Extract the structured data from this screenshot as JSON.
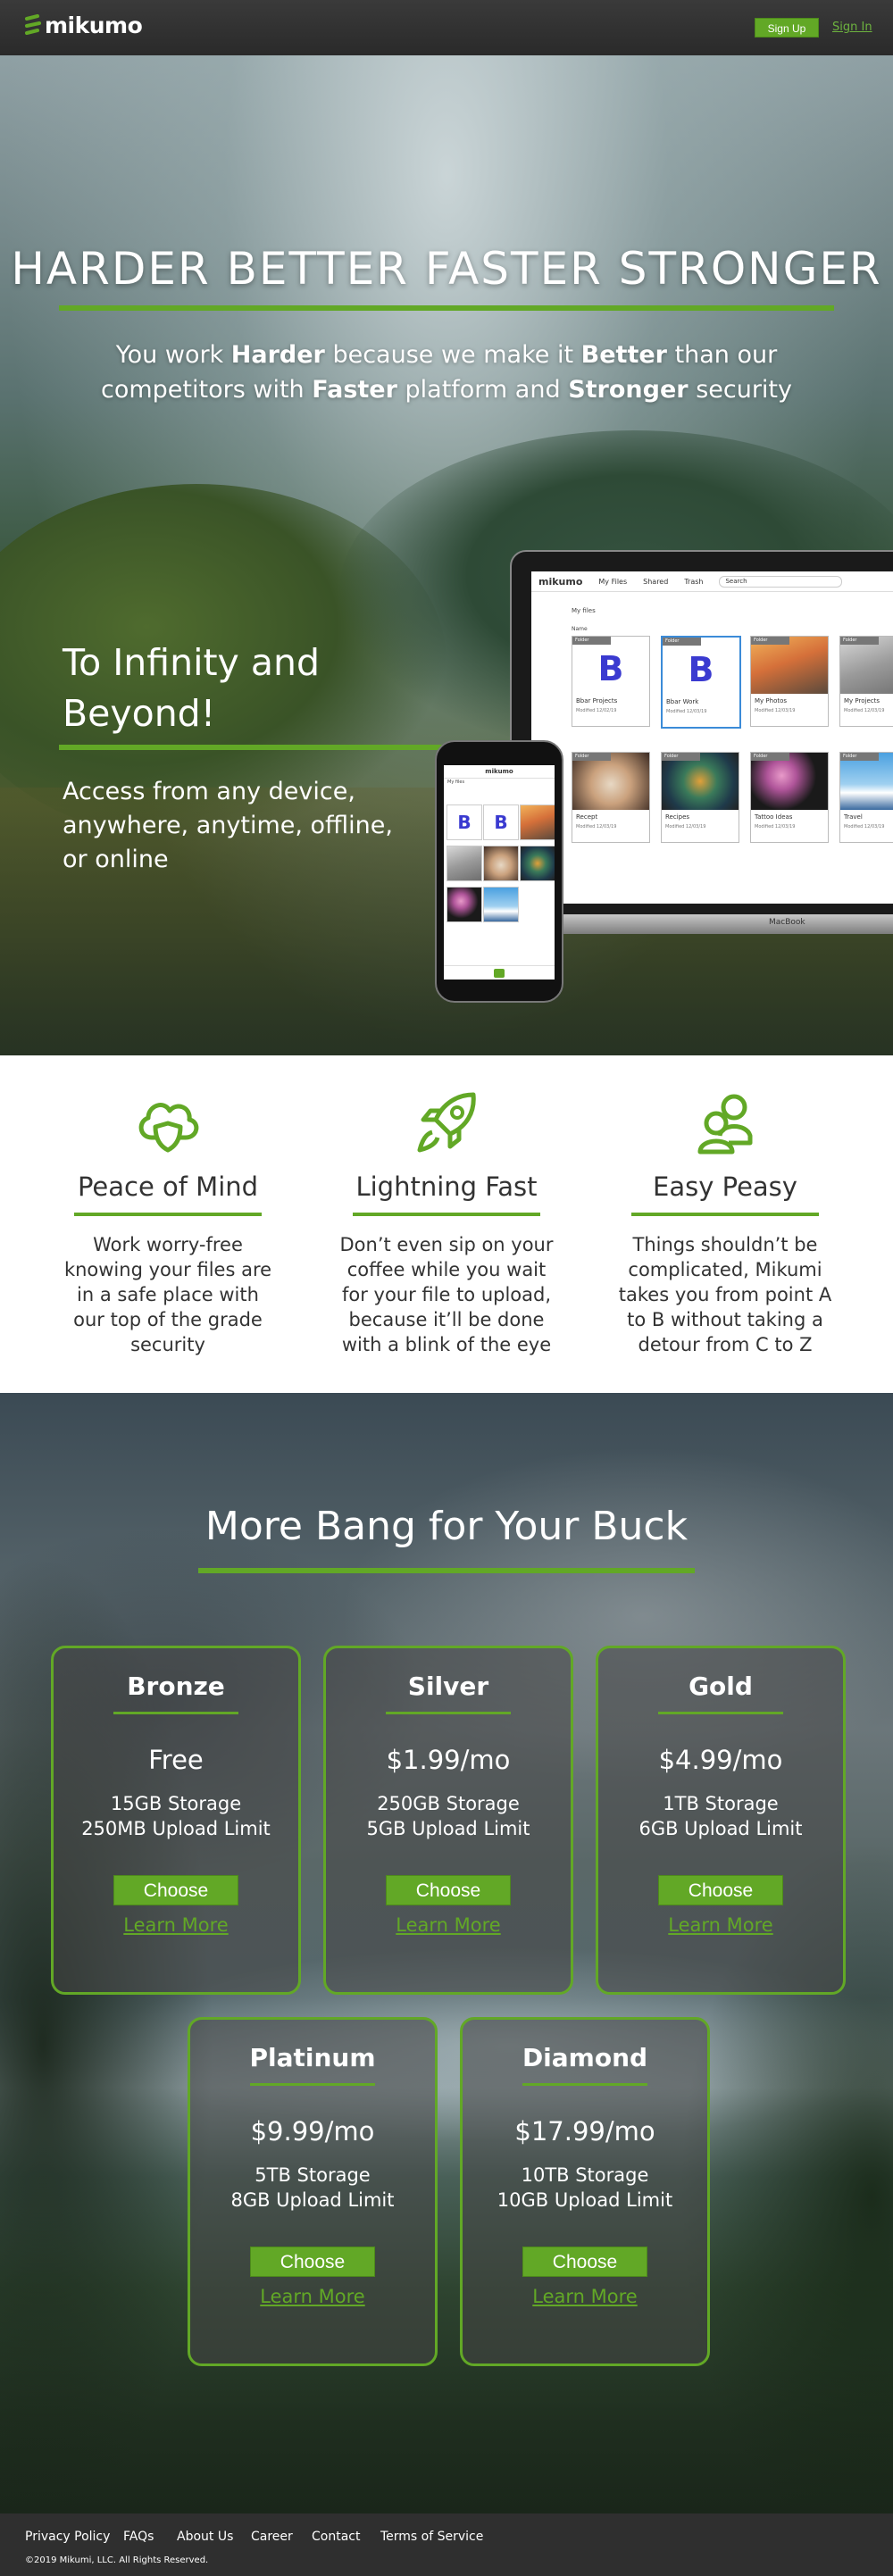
{
  "brand": {
    "name": "mikumo",
    "accent": "#62a826"
  },
  "nav": {
    "signup": "Sign Up",
    "signin": "Sign In"
  },
  "hero": {
    "title": "HARDER  BETTER  FASTER  STRONGER",
    "sub": [
      {
        "t": "You work ",
        "b": false
      },
      {
        "t": "Harder",
        "b": true
      },
      {
        "t": " because we make it ",
        "b": false
      },
      {
        "t": "Better",
        "b": true
      },
      {
        "t": " than our competitors with ",
        "b": false
      },
      {
        "t": "Faster",
        "b": true
      },
      {
        "t": " platform and ",
        "b": false
      },
      {
        "t": "Stronger",
        "b": true
      },
      {
        "t": " security",
        "b": false
      }
    ],
    "h2": "To Infinity and Beyond!",
    "p": "Access from any device, anywhere, anytime, offline, or online"
  },
  "app": {
    "logo": "mikumo",
    "menu": [
      "My Files",
      "Shared",
      "Trash"
    ],
    "search": "Search",
    "path": "My files",
    "sort": "Name",
    "laptop_label": "MacBook",
    "files": [
      {
        "tag": "Folder",
        "name": "Bbar Projects",
        "meta": "Modified 12/02/19",
        "thumb": "b-logo",
        "sel": false
      },
      {
        "tag": "Folder",
        "name": "Bbar Work",
        "meta": "Modified 12/03/19",
        "thumb": "b-logo",
        "sel": true
      },
      {
        "tag": "Folder",
        "name": "My Photos",
        "meta": "Modified 12/03/19",
        "thumb": "city",
        "sel": false
      },
      {
        "tag": "Folder",
        "name": "My Projects",
        "meta": "Modified 12/03/19",
        "thumb": "laptop",
        "sel": false
      },
      {
        "tag": "Folder",
        "name": "Recept",
        "meta": "Modified 12/03/19",
        "thumb": "tea",
        "sel": false
      },
      {
        "tag": "Folder",
        "name": "Recipes",
        "meta": "Modified 12/03/19",
        "thumb": "food",
        "sel": false
      },
      {
        "tag": "Folder",
        "name": "Tattoo Ideas",
        "meta": "Modified 12/03/19",
        "thumb": "blossom",
        "sel": false
      },
      {
        "tag": "Folder",
        "name": "Travel",
        "meta": "Modified 12/03/19",
        "thumb": "mountain",
        "sel": false
      }
    ]
  },
  "features": [
    {
      "icon": "cloud-shield-icon",
      "title": "Peace of Mind",
      "text": "Work worry-free knowing your files are in a safe place with our top of the grade security"
    },
    {
      "icon": "rocket-icon",
      "title": "Lightning Fast",
      "text": "Don’t even sip on your coffee while you wait for your file to upload, because it’ll be done with a blink of the eye"
    },
    {
      "icon": "users-icon",
      "title": "Easy Peasy",
      "text": "Things shouldn’t be complicated, Mikumi takes you from point A to B without taking a detour from C to Z"
    }
  ],
  "pricing": {
    "title": "More Bang for Your Buck",
    "choose": "Choose",
    "learn": "Learn More",
    "plans": [
      {
        "name": "Bronze",
        "price": "Free",
        "storage": "15GB Storage",
        "upload": "250MB Upload Limit"
      },
      {
        "name": "Silver",
        "price": "$1.99/mo",
        "storage": "250GB Storage",
        "upload": "5GB Upload Limit"
      },
      {
        "name": "Gold",
        "price": "$4.99/mo",
        "storage": "1TB Storage",
        "upload": "6GB Upload Limit"
      },
      {
        "name": "Platinum",
        "price": "$9.99/mo",
        "storage": "5TB Storage",
        "upload": "8GB Upload Limit"
      },
      {
        "name": "Diamond",
        "price": "$17.99/mo",
        "storage": "10TB Storage",
        "upload": "10GB Upload Limit"
      }
    ]
  },
  "footer": {
    "links": [
      "Privacy Policy",
      "FAQs",
      "About Us",
      "Career",
      "Contact",
      "Terms of Service"
    ],
    "copyright": "©2019 Mikumi, LLC. All Rights Reserved."
  }
}
